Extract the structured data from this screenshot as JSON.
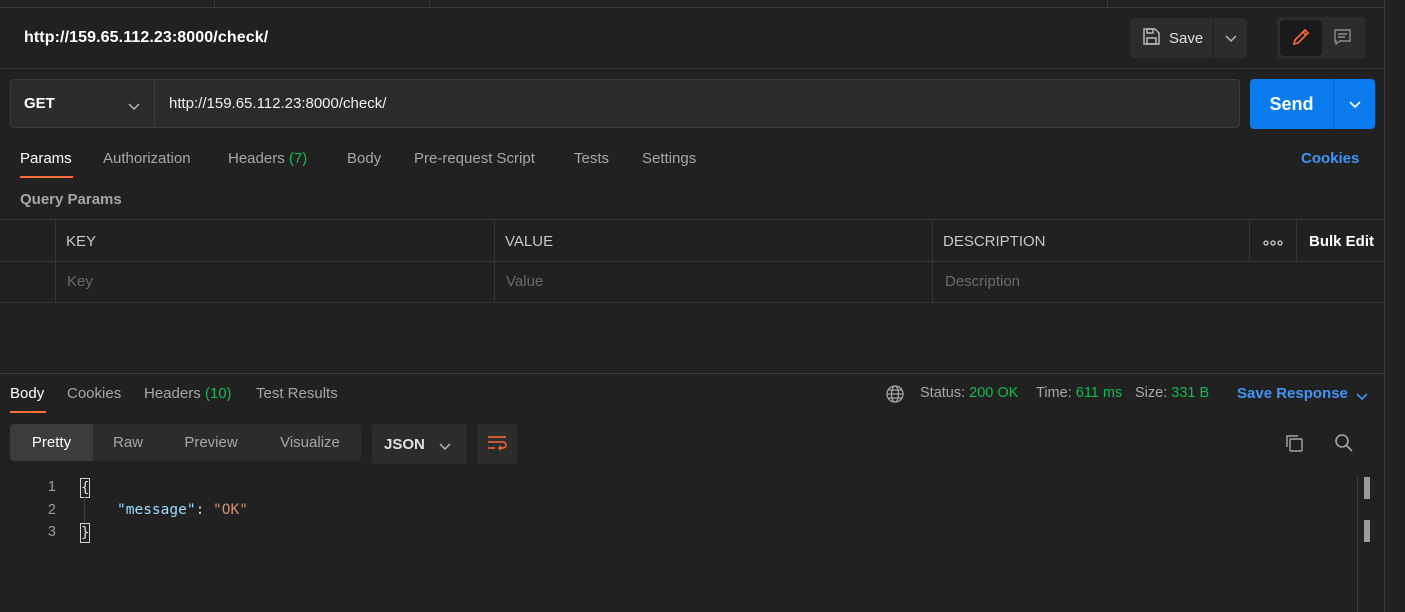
{
  "header": {
    "title": "http://159.65.112.23:8000/check/",
    "save_label": "Save"
  },
  "request": {
    "method": "GET",
    "url": "http://159.65.112.23:8000/check/",
    "send_label": "Send"
  },
  "request_tabs": {
    "params": "Params",
    "authorization": "Authorization",
    "headers": "Headers",
    "headers_count": "(7)",
    "body": "Body",
    "prerequest": "Pre-request Script",
    "tests": "Tests",
    "settings": "Settings",
    "cookies": "Cookies"
  },
  "query_params": {
    "title": "Query Params",
    "columns": {
      "key": "KEY",
      "value": "VALUE",
      "description": "DESCRIPTION"
    },
    "bulk_edit": "Bulk Edit",
    "placeholders": {
      "key": "Key",
      "value": "Value",
      "description": "Description"
    }
  },
  "response_tabs": {
    "body": "Body",
    "cookies": "Cookies",
    "headers": "Headers",
    "headers_count": "(10)",
    "test_results": "Test Results"
  },
  "response_status": {
    "status_label": "Status:",
    "status_value": "200 OK",
    "time_label": "Time:",
    "time_value": "611 ms",
    "size_label": "Size:",
    "size_value": "331 B",
    "save_response": "Save Response"
  },
  "view_modes": {
    "pretty": "Pretty",
    "raw": "Raw",
    "preview": "Preview",
    "visualize": "Visualize",
    "format": "JSON"
  },
  "code": {
    "line_numbers": [
      "1",
      "2",
      "3"
    ],
    "open_brace": "{",
    "close_brace": "}",
    "key": "\"message\"",
    "colon": ": ",
    "value": "\"OK\""
  },
  "colors": {
    "accent_orange": "#ff6c37",
    "send_blue": "#097bed",
    "link_blue": "#3f94f7",
    "status_green": "#0cbb52"
  },
  "icons": [
    "save-icon",
    "chevron-down-icon",
    "edit-pencil-icon",
    "comment-icon",
    "more-dots-icon",
    "globe-icon",
    "wrap-lines-icon",
    "copy-icon",
    "search-icon"
  ]
}
